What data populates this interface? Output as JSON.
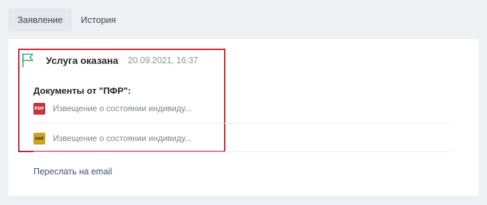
{
  "tabs": [
    {
      "label": "Заявление",
      "active": true
    },
    {
      "label": "История",
      "active": false
    }
  ],
  "event": {
    "status": "Услуга оказана",
    "timestamp": "20.09.2021, 16:37",
    "flag_icon": "flag-icon",
    "flag_color": "#3aa56a",
    "highlight_color": "#c7202e"
  },
  "documents": {
    "title": "Документы от \"ПФР\":",
    "items": [
      {
        "type_label": "PDF",
        "icon": "pdf-file-icon",
        "name": "Извещение о состоянии индивиду..."
      },
      {
        "type_label": "xml",
        "icon": "xml-file-icon",
        "name": "Извещение о состоянии индивиду..."
      }
    ]
  },
  "actions": {
    "forward_label": "Переслать на email"
  }
}
